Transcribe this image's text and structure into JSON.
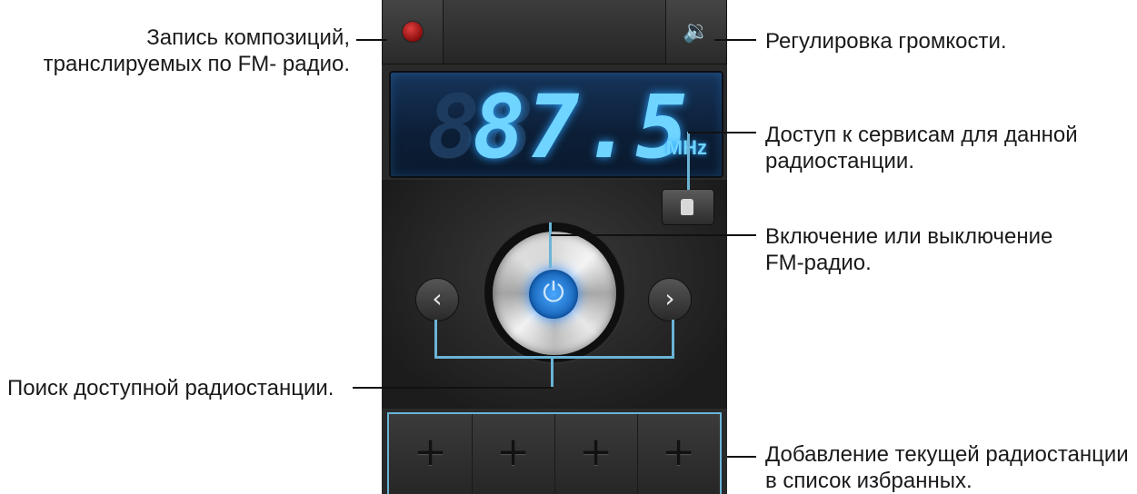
{
  "callouts": {
    "record": [
      "Запись композиций,",
      "транслируемых по FM- радио."
    ],
    "volume": "Регулировка громкости.",
    "services": [
      "Доступ к сервисам для данной",
      "радиостанции."
    ],
    "power": [
      "Включение или выключение",
      "FM-радио."
    ],
    "search": "Поиск доступной радиостанции.",
    "favorites": [
      "Добавление текущей радиостанции",
      "в список избранных."
    ]
  },
  "display": {
    "ghost_digits": "88",
    "frequency": "87.5",
    "unit": "MHz"
  },
  "buttons": {
    "prev": "‹",
    "next": "›",
    "power_icon": "⏻",
    "volume_icon": "🔉"
  },
  "favorites": [
    "+",
    "+",
    "+",
    "+"
  ],
  "colors": {
    "display_text": "#6fd4ff",
    "power_button": "#2a8cff",
    "record_dot": "#c01c1c",
    "highlight": "#6ab4d6"
  }
}
